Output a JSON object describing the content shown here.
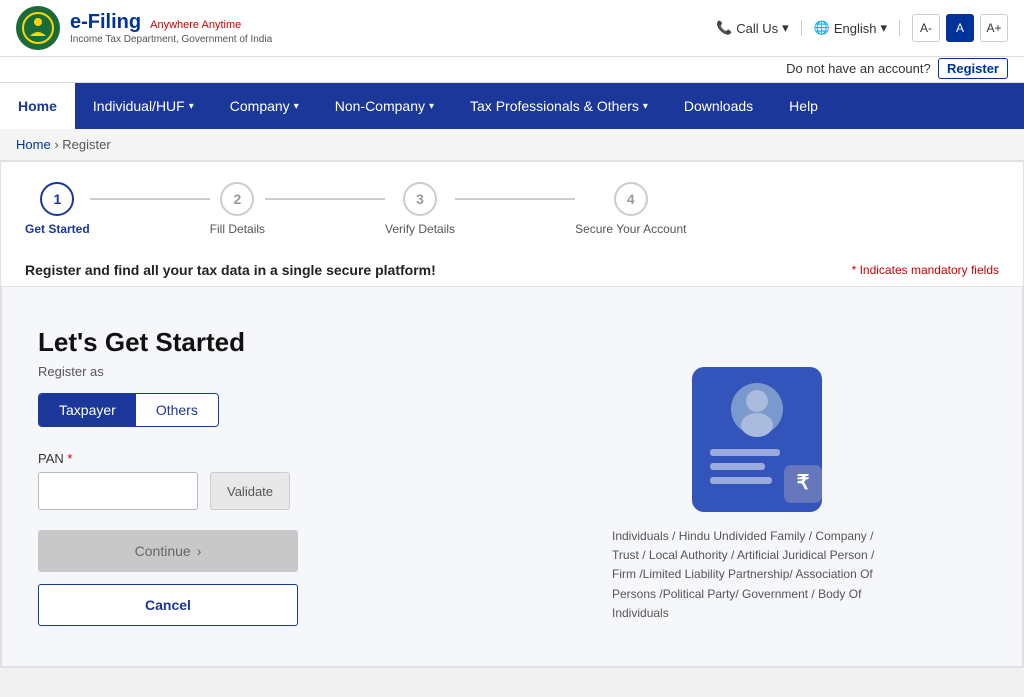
{
  "topbar": {
    "logo_efiling": "e-Filing",
    "logo_tagline": "Anywhere Anytime",
    "logo_subtitle": "Income Tax Department, Government of India",
    "call_us": "Call Us",
    "language": "English",
    "font_small": "A-",
    "font_medium": "A",
    "font_large": "A+",
    "register_prompt": "Do not have an account?",
    "register_link": "Register"
  },
  "nav": {
    "items": [
      {
        "label": "Home",
        "active": true,
        "has_dropdown": false
      },
      {
        "label": "Individual/HUF",
        "has_dropdown": true
      },
      {
        "label": "Company",
        "has_dropdown": true
      },
      {
        "label": "Non-Company",
        "has_dropdown": true
      },
      {
        "label": "Tax Professionals & Others",
        "has_dropdown": true
      },
      {
        "label": "Downloads",
        "has_dropdown": false
      },
      {
        "label": "Help",
        "has_dropdown": false
      }
    ]
  },
  "breadcrumb": {
    "home": "Home",
    "current": "Register"
  },
  "stepper": {
    "steps": [
      {
        "number": "1",
        "label": "Get Started",
        "active": true
      },
      {
        "number": "2",
        "label": "Fill Details",
        "active": false
      },
      {
        "number": "3",
        "label": "Verify Details",
        "active": false
      },
      {
        "number": "4",
        "label": "Secure Your Account",
        "active": false
      }
    ]
  },
  "tagline": "Register and find all your tax data in a single secure platform!",
  "mandatory_note": "* Indicates mandatory fields",
  "form": {
    "title": "Let's Get Started",
    "register_as_label": "Register as",
    "toggle_taxpayer": "Taxpayer",
    "toggle_others": "Others",
    "pan_label": "PAN",
    "pan_placeholder": "",
    "validate_btn": "Validate",
    "continue_btn": "Continue",
    "cancel_btn": "Cancel"
  },
  "caption": "Individuals / Hindu Undivided Family / Company / Trust / Local Authority / Artificial Juridical Person / Firm /Limited Liability Partnership/ Association Of Persons /Political Party/ Government / Body Of Individuals"
}
